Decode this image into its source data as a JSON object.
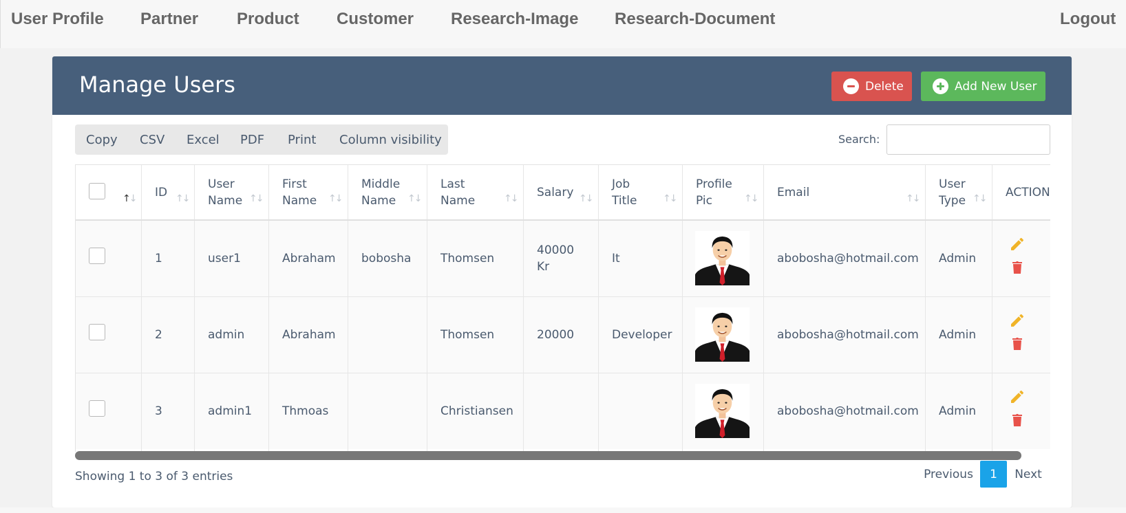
{
  "nav": {
    "user_profile": "User Profile",
    "partner": "Partner",
    "product": "Product",
    "customer": "Customer",
    "research_image": "Research-Image",
    "research_document": "Research-Document",
    "logout": "Logout"
  },
  "page": {
    "title": "Manage Users",
    "delete_label": "Delete",
    "add_label": "Add New User"
  },
  "colors": {
    "header_bg": "#475f7b",
    "delete": "#d9534f",
    "add": "#5cb85c",
    "edit_icon": "#f0b429",
    "trash_icon": "#e8524a",
    "active_page": "#1aa3e8"
  },
  "toolbar": {
    "copy": "Copy",
    "csv": "CSV",
    "excel": "Excel",
    "pdf": "PDF",
    "print": "Print",
    "colvis": "Column visibility"
  },
  "search": {
    "label": "Search:",
    "value": ""
  },
  "table": {
    "headers": {
      "id": "ID",
      "user_name_1": "User",
      "user_name_2": "Name",
      "first_name_1": "First",
      "first_name_2": "Name",
      "middle_name_1": "Middle",
      "middle_name_2": "Name",
      "last_name_1": "Last",
      "last_name_2": "Name",
      "salary": "Salary",
      "job_title_1": "Job",
      "job_title_2": "Title",
      "profile_pic_1": "Profile",
      "profile_pic_2": "Pic",
      "email": "Email",
      "user_type_1": "User",
      "user_type_2": "Type",
      "action": "ACTION"
    },
    "rows": [
      {
        "id": "1",
        "user_name": "user1",
        "first_name": "Abraham",
        "middle_name": "bobosha",
        "last_name": "Thomsen",
        "salary_1": "40000",
        "salary_2": "Kr",
        "job_title": "It",
        "email": "abobosha@hotmail.com",
        "user_type": "Admin"
      },
      {
        "id": "2",
        "user_name": "admin",
        "first_name": "Abraham",
        "middle_name": "",
        "last_name": "Thomsen",
        "salary_1": "20000",
        "salary_2": "",
        "job_title": "Developer",
        "email": "abobosha@hotmail.com",
        "user_type": "Admin"
      },
      {
        "id": "3",
        "user_name": "admin1",
        "first_name": "Thmoas",
        "middle_name": "",
        "last_name": "Christiansen",
        "salary_1": "",
        "salary_2": "",
        "job_title": "",
        "email": "abobosha@hotmail.com",
        "user_type": "Admin"
      }
    ]
  },
  "footer": {
    "info": "Showing 1 to 3 of 3 entries",
    "previous": "Previous",
    "current_page": "1",
    "next": "Next"
  }
}
